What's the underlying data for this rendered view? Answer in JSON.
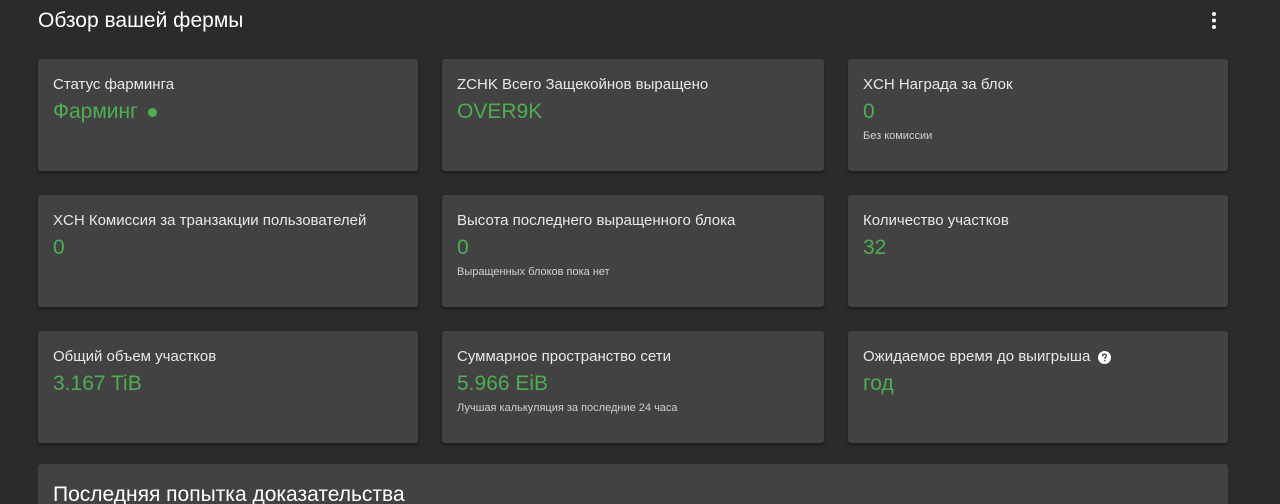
{
  "header": {
    "title": "Обзор вашей фермы",
    "more_icon": "more-vert-icon"
  },
  "cards": [
    {
      "title": "Статус фарминга",
      "value": "Фарминг",
      "status_color": "#4caf50"
    },
    {
      "title": "ZCHK Всего Защекойнов выращено",
      "value": "OVER9K"
    },
    {
      "title": "XCH Награда за блок",
      "value": "0",
      "sub": "Без комиссии"
    },
    {
      "title": "XCH Комиссия за транзакции пользователей",
      "value": "0"
    },
    {
      "title": "Высота последнего выращенного блока",
      "value": "0",
      "sub": "Выращенных блоков пока нет"
    },
    {
      "title": "Количество участков",
      "value": "32"
    },
    {
      "title": "Общий объем участков",
      "value": "3.167 TiB"
    },
    {
      "title": "Суммарное пространство сети",
      "value": "5.966 EiB",
      "sub": "Лучшая калькуляция за последние 24 часа"
    },
    {
      "title": "Ожидаемое время до выигрыша",
      "value": "год",
      "help_icon": "help-circle-icon"
    }
  ],
  "bottom_section": {
    "title": "Последняя попытка доказательства"
  },
  "colors": {
    "background": "#2b2b2b",
    "card": "#424242",
    "accent": "#4caf50"
  }
}
